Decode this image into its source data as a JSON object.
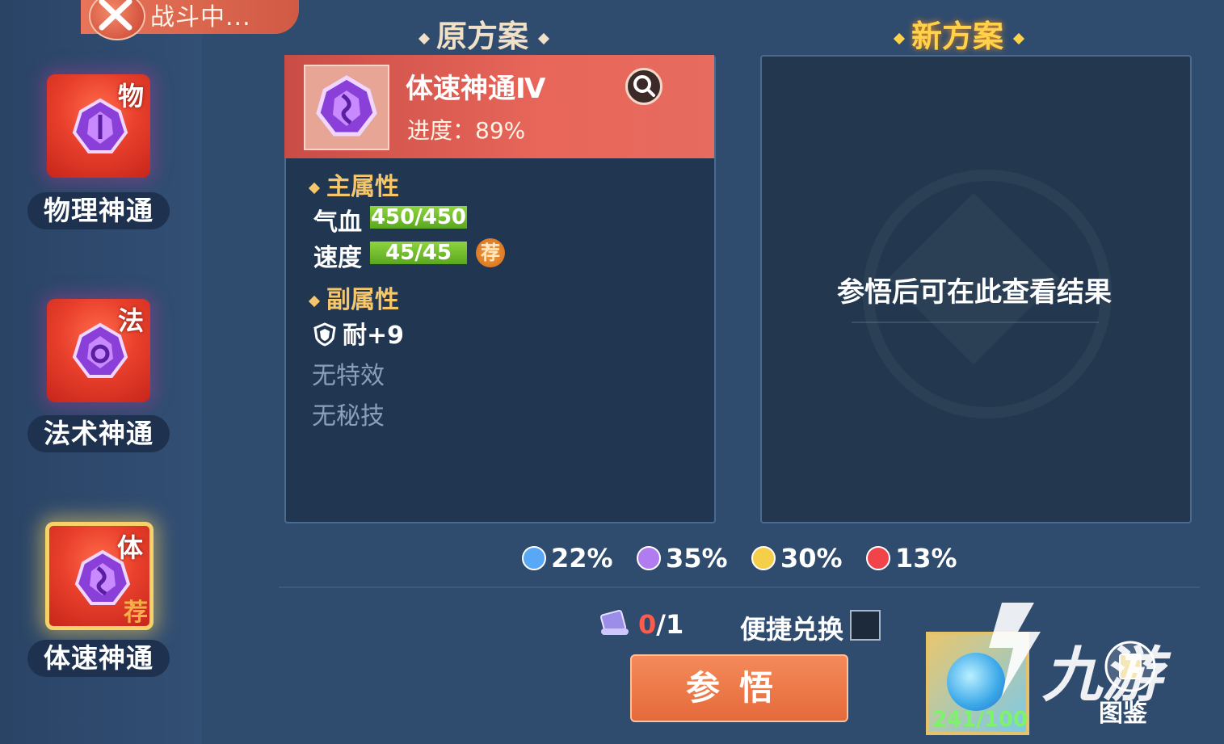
{
  "status": {
    "battle_text": "战斗中..."
  },
  "sidebar": {
    "items": [
      {
        "tag": "物",
        "label": "物理神通",
        "selected": false,
        "recommended": false
      },
      {
        "tag": "法",
        "label": "法术神通",
        "selected": false,
        "recommended": false
      },
      {
        "tag": "体",
        "label": "体速神通",
        "selected": true,
        "recommended": true,
        "rec_text": "荐"
      }
    ]
  },
  "original": {
    "header": "原方案",
    "item_name": "体速神通Ⅳ",
    "progress": "进度：89%",
    "main_attr_title": "主属性",
    "main_attrs": [
      {
        "name": "气血",
        "value": "450/450",
        "fill": 1.0,
        "recommended": false
      },
      {
        "name": "速度",
        "value": "45/45",
        "fill": 1.0,
        "recommended": true,
        "rec_text": "荐"
      }
    ],
    "sub_attr_title": "副属性",
    "sub_attr": "耐+9",
    "no_effect": "无特效",
    "no_skill": "无秘技"
  },
  "new_plan": {
    "header": "新方案",
    "hint": "参悟后可在此查看结果"
  },
  "odds": [
    {
      "color": "#58a8f5",
      "value": "22%"
    },
    {
      "color": "#b07cf0",
      "value": "35%"
    },
    {
      "color": "#f6cf4a",
      "value": "30%"
    },
    {
      "color": "#f0434a",
      "value": "13%"
    }
  ],
  "controls": {
    "count_have": "0",
    "count_need": "/1",
    "exchange_label": "便捷兑换",
    "exchange_checked": false,
    "comprehend_button": "参悟",
    "resource_count": "241/100",
    "atlas_label": "图鉴"
  },
  "watermark": {
    "logo_text": "九游"
  },
  "colors": {
    "accent_gold": "#f5c66a",
    "panel_red": "#e8665a",
    "bar_green": "#6fbe2c"
  }
}
